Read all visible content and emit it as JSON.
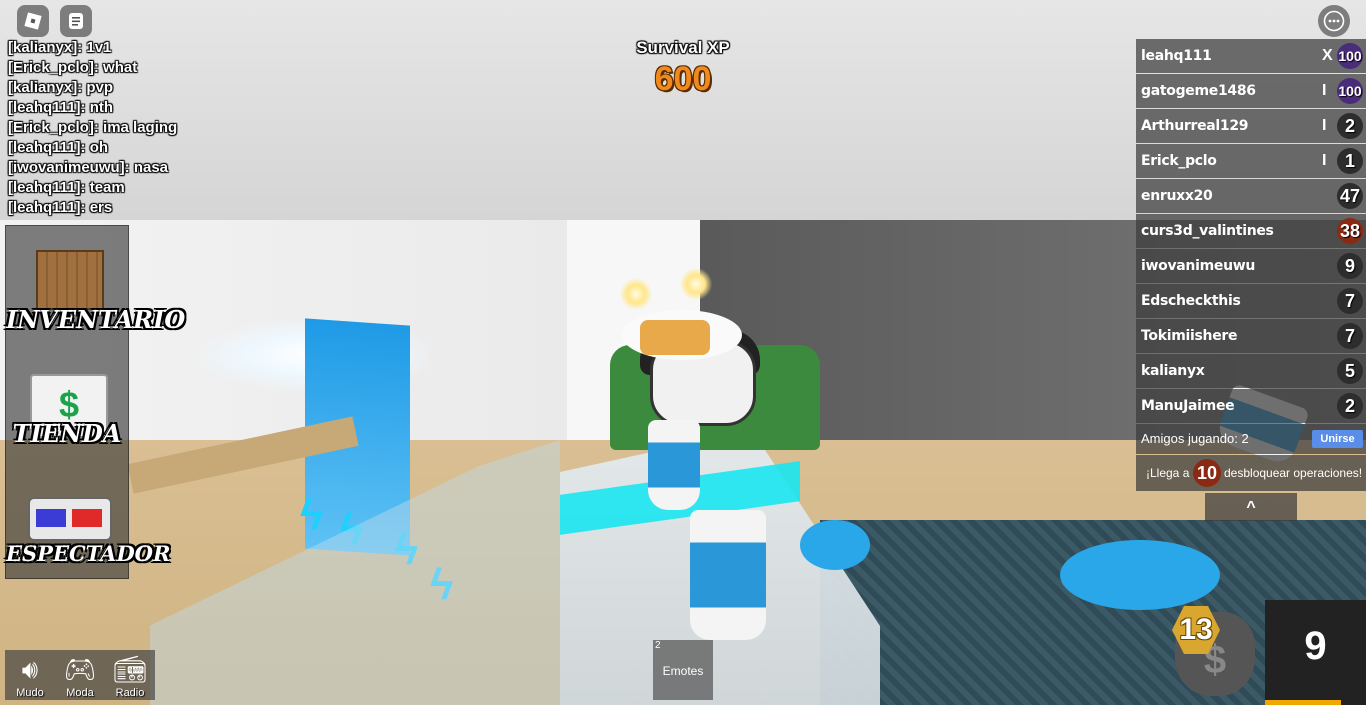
{
  "top_icons": {
    "roblox": "roblox-logo-icon",
    "chat": "chat-icon",
    "more": "more-options-icon"
  },
  "chat": {
    "messages": [
      "[kalianyx]: 1v1",
      "[Erick_pclo]: what",
      "[kalianyx]: pvp",
      "[leahq111]: nth",
      "[Erick_pclo]: ima laging",
      "[leahq111]: oh",
      "[iwovanimeuwu]: nasa",
      "[leahq111]: team",
      "[leahq111]: ers"
    ]
  },
  "xp": {
    "title": "Survival XP",
    "value": "600",
    "value_color": "#f08a1c"
  },
  "left_menu": {
    "inventory": "INVENTARIO",
    "shop": "TIENDA",
    "shop_symbol": "$",
    "spectate": "ESPECTADOR"
  },
  "bottom_left": {
    "mute": "Mudo",
    "mode": "Moda",
    "radio": "Radio"
  },
  "emotes": {
    "count": "2",
    "label": "Emotes"
  },
  "leaderboard": {
    "players": [
      {
        "name": "leahq111",
        "tag": "X",
        "level": "100"
      },
      {
        "name": "gatogeme1486",
        "tag": "I",
        "level": "100"
      },
      {
        "name": "Arthurreal129",
        "tag": "I",
        "level": "2"
      },
      {
        "name": "Erick_pclo",
        "tag": "I",
        "level": "1"
      },
      {
        "name": "enruxx20",
        "tag": "",
        "level": "47"
      },
      {
        "name": "curs3d_valintines",
        "tag": "",
        "level": "38"
      },
      {
        "name": "iwovanimeuwu",
        "tag": "",
        "level": "9"
      },
      {
        "name": "Edscheckthis",
        "tag": "",
        "level": "7"
      },
      {
        "name": "Tokimiishere",
        "tag": "",
        "level": "7"
      },
      {
        "name": "kalianyx",
        "tag": "",
        "level": "5"
      },
      {
        "name": "ManuJaimee",
        "tag": "",
        "level": "2"
      }
    ],
    "friends_playing": "Amigos jugando: 2",
    "join": "Unirse",
    "unlock_prefix": "¡Llega a 1",
    "unlock_level": "10",
    "unlock_suffix": "desbloquear operaciones!",
    "collapse": "^"
  },
  "player_level": "13",
  "money_symbol": "$",
  "timer": {
    "value": "9",
    "progress": 0.75,
    "bar_color": "#f0a800"
  }
}
